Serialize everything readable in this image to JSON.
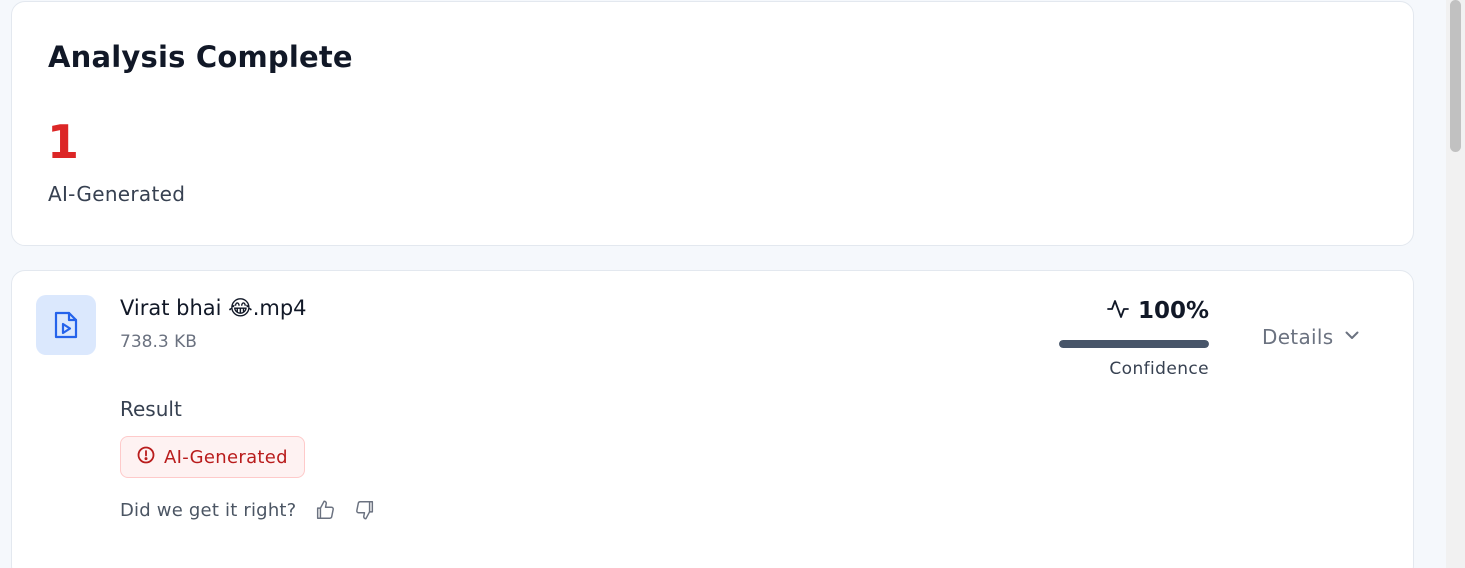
{
  "summary": {
    "title": "Analysis Complete",
    "count": "1",
    "count_label": "AI-Generated"
  },
  "file": {
    "name": "Virat bhai 😂.mp4",
    "size": "738.3 KB",
    "icon": "video-file-icon",
    "confidence": {
      "value_text": "100%",
      "value": 100,
      "label": "Confidence",
      "icon": "activity-icon"
    },
    "details": {
      "label": "Details",
      "icon": "chevron-down-icon"
    },
    "result": {
      "heading": "Result",
      "badge_label": "AI-Generated",
      "badge_icon": "alert-circle-icon"
    },
    "feedback": {
      "prompt": "Did we get it right?",
      "thumbs_up_icon": "thumbs-up-icon",
      "thumbs_down_icon": "thumbs-down-icon"
    }
  },
  "colors": {
    "ai_red": "#dc2626",
    "badge_bg": "#fef2f2",
    "icon_blue": "#2563eb",
    "icon_bg": "#dbe8fd",
    "bar_fill": "#475569"
  }
}
